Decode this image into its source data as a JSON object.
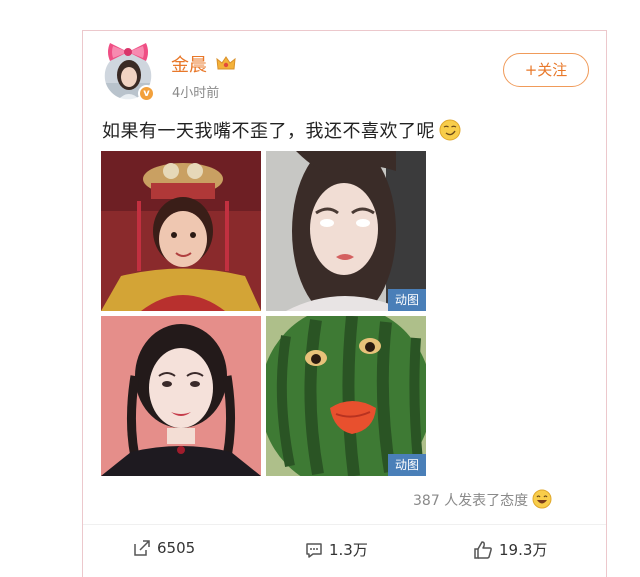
{
  "post": {
    "username": "金晨",
    "time": "4小时前",
    "follow_label": "+关注",
    "text": "如果有一天我嘴不歪了，我还不喜欢了呢",
    "verified_badge": "v",
    "images": [
      {
        "gif": false
      },
      {
        "gif": true,
        "badge": "动图"
      },
      {
        "gif": false
      },
      {
        "gif": true,
        "badge": "动图"
      }
    ],
    "reactions_text": "387 人发表了态度",
    "actions": {
      "share": "6505",
      "comment": "1.3万",
      "like": "19.3万"
    }
  },
  "colors": {
    "username": "#e8782a",
    "follow_border": "#f09b5a",
    "gif_badge": "#4a7fb8",
    "card_border": "#ecc8cc"
  },
  "icons": [
    "bow-icon",
    "crown-icon",
    "verified-icon",
    "smirk-emoji-icon",
    "laugh-emoji-icon",
    "share-icon",
    "comment-icon",
    "like-icon"
  ]
}
